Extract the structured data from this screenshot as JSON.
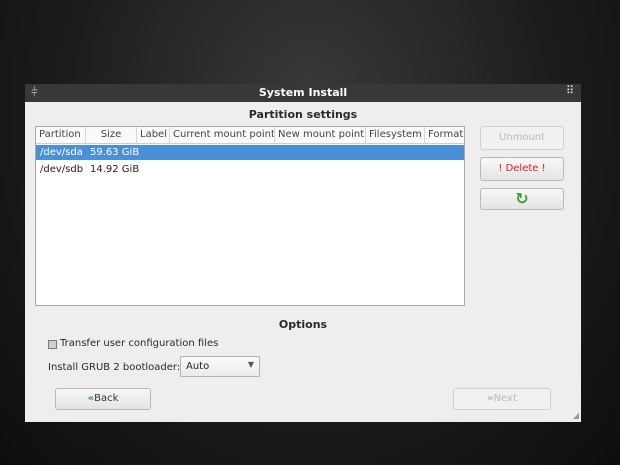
{
  "window": {
    "title": "System Install",
    "left_icon": "⫩",
    "right_icon": "⠿"
  },
  "partition_settings": {
    "heading": "Partition settings",
    "columns": [
      "Partition",
      "Size",
      "Label",
      "Current mount point",
      "New mount point",
      "Filesystem",
      "Format"
    ],
    "rows": [
      {
        "partition": "/dev/sda",
        "size": "59.63 GiB",
        "selected": true
      },
      {
        "partition": "/dev/sdb",
        "size": "14.92 GiB",
        "selected": false
      }
    ],
    "buttons": {
      "unmount": "Unmount",
      "delete": "! Delete !",
      "refresh_icon": "↻"
    }
  },
  "options": {
    "heading": "Options",
    "transfer_label": "Transfer user configuration files",
    "grub_label": "Install GRUB 2 bootloader:",
    "grub_value": "Auto",
    "grub_arrow": "▼"
  },
  "nav": {
    "back_icon": "«",
    "back_label": "Back",
    "next_icon": "»",
    "next_label": "Next"
  },
  "colors": {
    "selection": "#4a90d9",
    "delete_text": "#d62020",
    "nav_icon": "#3aa03a"
  }
}
